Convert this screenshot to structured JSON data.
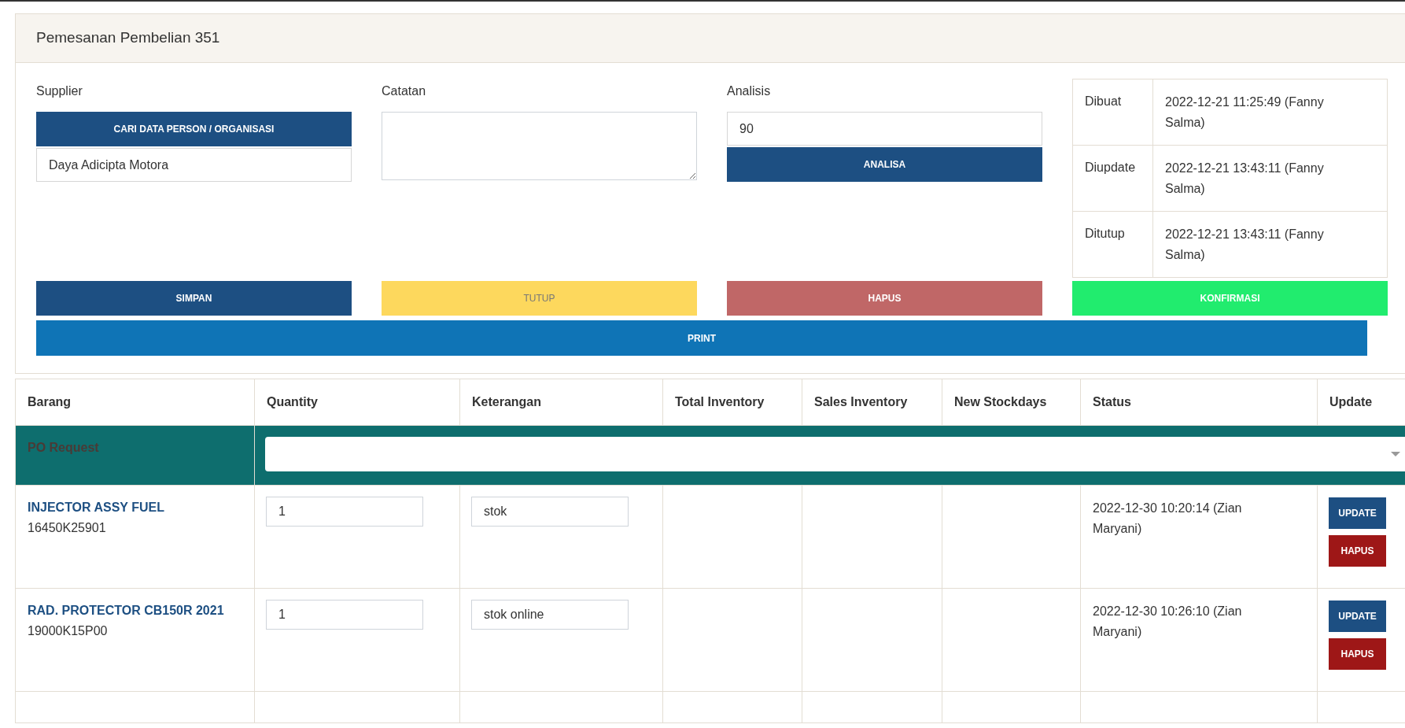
{
  "title": "Pemesanan Pembelian 351",
  "supplier": {
    "label": "Supplier",
    "search_button": "CARI DATA PERSON / ORGANISASI",
    "value": "Daya Adicipta Motora"
  },
  "notes": {
    "label": "Catatan"
  },
  "analysis": {
    "label": "Analisis",
    "value": "90",
    "button": "ANALISA"
  },
  "audit": [
    {
      "label": "Dibuat",
      "value": "2022-12-21 11:25:49 (Fanny Salma)"
    },
    {
      "label": "Diupdate",
      "value": "2022-12-21 13:43:11 (Fanny Salma)"
    },
    {
      "label": "Ditutup",
      "value": "2022-12-21 13:43:11 (Fanny Salma)"
    }
  ],
  "actions": [
    {
      "label": "SIMPAN",
      "kind": "save"
    },
    {
      "label": "TUTUP",
      "kind": "close"
    },
    {
      "label": "HAPUS",
      "kind": "delete"
    },
    {
      "label": "KONFIRMASI",
      "kind": "confirm"
    }
  ],
  "print_button": "PRINT",
  "table": {
    "columns": [
      "Barang",
      "Quantity",
      "Keterangan",
      "Total Inventory",
      "Sales Inventory",
      "New Stockdays",
      "Status",
      "Update"
    ],
    "po_request": {
      "label": "PO Request"
    },
    "rows": [
      {
        "name": "INJECTOR ASSY FUEL",
        "code": "16450K25901",
        "quantity": "1",
        "note": "stok",
        "status": "2022-12-30 10:20:14 (Zian Maryani)",
        "update_button": "UPDATE",
        "delete_button": "HAPUS"
      },
      {
        "name": "RAD. PROTECTOR CB150R 2021",
        "code": "19000K15P00",
        "quantity": "1",
        "note": "stok online",
        "status": "2022-12-30 10:26:10 (Zian Maryani)",
        "update_button": "UPDATE",
        "delete_button": "HAPUS"
      }
    ]
  }
}
